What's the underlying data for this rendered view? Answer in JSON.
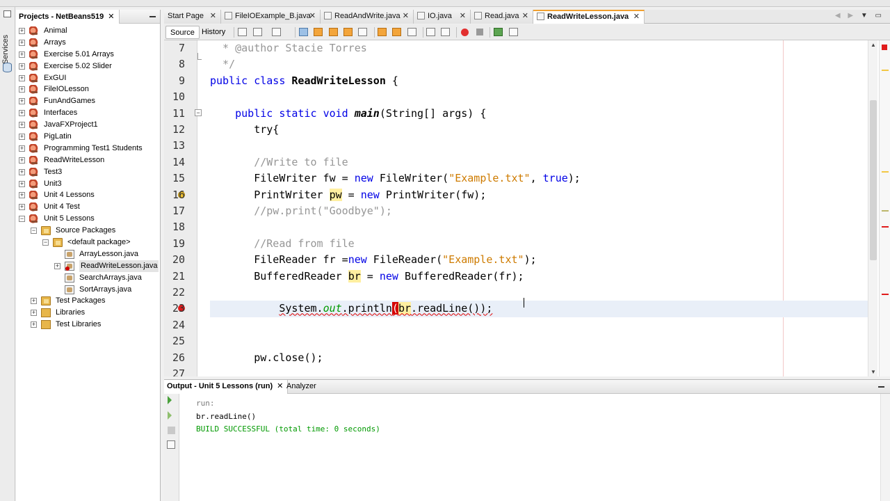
{
  "projects_panel": {
    "title": "Projects - NetBeans519",
    "tree": [
      {
        "label": "Animal",
        "type": "project",
        "depth": 0,
        "expanded": false
      },
      {
        "label": "Arrays",
        "type": "project",
        "depth": 0,
        "expanded": false
      },
      {
        "label": "Exercise 5.01 Arrays",
        "type": "project",
        "depth": 0,
        "expanded": false
      },
      {
        "label": "Exercise 5.02 Slider",
        "type": "project",
        "depth": 0,
        "expanded": false
      },
      {
        "label": "ExGUI",
        "type": "project",
        "depth": 0,
        "expanded": false
      },
      {
        "label": "FileIOLesson",
        "type": "project",
        "depth": 0,
        "expanded": false
      },
      {
        "label": "FunAndGames",
        "type": "project",
        "depth": 0,
        "expanded": false
      },
      {
        "label": "Interfaces",
        "type": "project",
        "depth": 0,
        "expanded": false
      },
      {
        "label": "JavaFXProject1",
        "type": "project",
        "depth": 0,
        "expanded": false
      },
      {
        "label": "PigLatin",
        "type": "project",
        "depth": 0,
        "expanded": false
      },
      {
        "label": "Programming Test1 Students",
        "type": "project",
        "depth": 0,
        "expanded": false
      },
      {
        "label": "ReadWriteLesson",
        "type": "project",
        "depth": 0,
        "expanded": false
      },
      {
        "label": "Test3",
        "type": "project",
        "depth": 0,
        "expanded": false
      },
      {
        "label": "Unit3",
        "type": "project",
        "depth": 0,
        "expanded": false
      },
      {
        "label": "Unit 4 Lessons",
        "type": "project",
        "depth": 0,
        "expanded": false
      },
      {
        "label": "Unit 4 Test",
        "type": "project",
        "depth": 0,
        "expanded": false
      },
      {
        "label": "Unit 5 Lessons",
        "type": "project",
        "depth": 0,
        "expanded": true
      },
      {
        "label": "Source Packages",
        "type": "package-folder",
        "depth": 1,
        "expanded": true
      },
      {
        "label": "<default package>",
        "type": "package",
        "depth": 2,
        "expanded": true
      },
      {
        "label": "ArrayLesson.java",
        "type": "java",
        "depth": 3
      },
      {
        "label": "ReadWriteLesson.java",
        "type": "java-error",
        "depth": 3,
        "selected": true
      },
      {
        "label": "SearchArrays.java",
        "type": "java",
        "depth": 3
      },
      {
        "label": "SortArrays.java",
        "type": "java",
        "depth": 3
      },
      {
        "label": "Test Packages",
        "type": "package-folder",
        "depth": 1,
        "expanded": false
      },
      {
        "label": "Libraries",
        "type": "library",
        "depth": 1,
        "expanded": false
      },
      {
        "label": "Test Libraries",
        "type": "library",
        "depth": 1,
        "expanded": false
      }
    ]
  },
  "services_label": "Services",
  "editor_tabs": [
    {
      "label": "Start Page",
      "active": false
    },
    {
      "label": "FileIOExample_B.java",
      "active": false
    },
    {
      "label": "ReadAndWrite.java",
      "active": false
    },
    {
      "label": "IO.java",
      "active": false
    },
    {
      "label": "Read.java",
      "active": false
    },
    {
      "label": "ReadWriteLesson.java",
      "active": true
    }
  ],
  "toolbar": {
    "source_label": "Source",
    "history_label": "History"
  },
  "code": {
    "line_numbers": [
      "7",
      "8",
      "9",
      "10",
      "11",
      "12",
      "13",
      "14",
      "15",
      "16",
      "17",
      "18",
      "19",
      "20",
      "21",
      "22",
      "23",
      "24",
      "25",
      "26",
      "27"
    ],
    "lines": [
      "  * @author Stacie Torres",
      "  */",
      "public class ReadWriteLesson {",
      "",
      "    public static void main(String[] args) {",
      "       try{",
      "",
      "       //Write to file",
      "       FileWriter fw = new FileWriter(\"Example.txt\", true);",
      "       PrintWriter pw = new PrintWriter(fw);",
      "       //pw.print(\"Goodbye\");",
      "",
      "       //Read from file",
      "       FileReader fr =new FileReader(\"Example.txt\");",
      "       BufferedReader br = new BufferedReader(fr);",
      "",
      "           System.out.println(br.readLine());",
      "",
      "",
      "       pw.close();",
      ""
    ]
  },
  "output": {
    "tab_label": "Output - Unit 5 Lessons (run)",
    "analyzer_label": "Analyzer",
    "lines": [
      {
        "text": "run:",
        "color": "#7a7a7a"
      },
      {
        "text": "br.readLine()",
        "color": "#000000"
      },
      {
        "text": "BUILD SUCCESSFUL (total time: 0 seconds)",
        "color": "#009900"
      }
    ]
  }
}
